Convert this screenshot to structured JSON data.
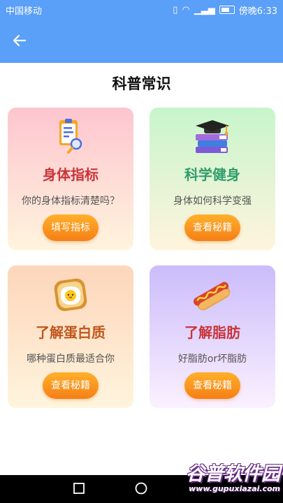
{
  "status_bar": {
    "carrier": "中国移动",
    "time": "傍晚6:33"
  },
  "page": {
    "title": "科普常识"
  },
  "cards": [
    {
      "title": "身体指标",
      "desc": "你的身体指标清楚吗？",
      "button": "填写指标",
      "icon": "clipboard-icon"
    },
    {
      "title": "科学健身",
      "desc": "身体如何科学变强",
      "button": "查看秘籍",
      "icon": "books-graduation-icon"
    },
    {
      "title": "了解蛋白质",
      "desc": "哪种蛋白质最适合你",
      "button": "查看秘籍",
      "icon": "egg-toast-icon"
    },
    {
      "title": "了解脂肪",
      "desc": "好脂肪or坏脂肪",
      "button": "查看秘籍",
      "icon": "hotdog-icon"
    }
  ],
  "watermark": {
    "main": "谷普软件园",
    "sub": "www.gupuxiazai.com"
  },
  "colors": {
    "appbar": "#5a9ff8",
    "button": "#f7931e"
  }
}
